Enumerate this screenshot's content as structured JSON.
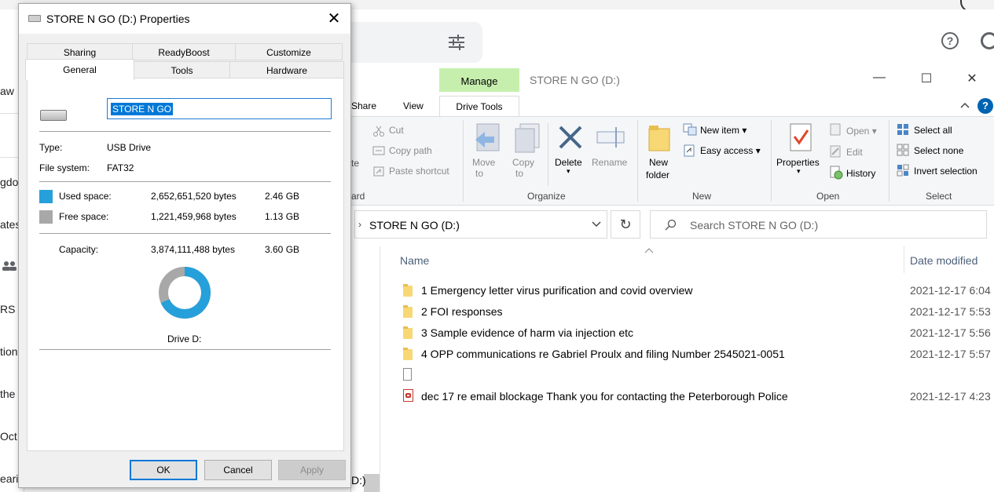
{
  "browser": {
    "left_fragments": [
      "aw",
      "gdo",
      "ates",
      "RS c",
      "tion",
      "the",
      "Oct",
      "earin"
    ],
    "help_label": "?"
  },
  "explorer": {
    "manage_label": "Manage",
    "title": "STORE N GO (D:)",
    "window_controls": {
      "minimize": "—",
      "maximize": "☐",
      "close": "✕"
    },
    "tabs": {
      "share": "Share",
      "view": "View",
      "drive_tools": "Drive Tools"
    },
    "ribbon": {
      "clipboard": {
        "cut": "Cut",
        "copy_path": "Copy path",
        "paste_shortcut": "Paste shortcut",
        "paste_fragment": "te",
        "group_fragment": "ard"
      },
      "organize": {
        "move_to_1": "Move",
        "move_to_2": "to",
        "copy_to_1": "Copy",
        "copy_to_2": "to",
        "delete": "Delete",
        "rename": "Rename",
        "group": "Organize"
      },
      "new": {
        "new_folder_1": "New",
        "new_folder_2": "folder",
        "new_item": "New item",
        "easy_access": "Easy access",
        "group": "New"
      },
      "open": {
        "properties": "Properties",
        "open": "Open",
        "edit": "Edit",
        "history": "History",
        "group": "Open"
      },
      "select": {
        "select_all": "Select all",
        "select_none": "Select none",
        "invert_selection": "Invert selection",
        "group": "Select"
      }
    },
    "address": {
      "path": "STORE N GO (D:)"
    },
    "search": {
      "placeholder": "Search STORE N GO (D:)"
    },
    "columns": {
      "name": "Name",
      "date_modified": "Date modified"
    },
    "files": [
      {
        "type": "folder",
        "name": "1 Emergency letter virus purification and covid overview",
        "date": "2021-12-17 6:04"
      },
      {
        "type": "folder",
        "name": "2 FOI responses",
        "date": "2021-12-17 5:53"
      },
      {
        "type": "folder",
        "name": "3 Sample evidence of harm via injection etc",
        "date": "2021-12-17 5:56"
      },
      {
        "type": "folder",
        "name": "4 OPP communications re Gabriel Proulx and filing Number 2545021-0051",
        "date": "2021-12-17 5:57"
      },
      {
        "type": "file",
        "name": "",
        "date": ""
      },
      {
        "type": "pdf",
        "name": "dec 17 re email blockage Thank you for contacting the Peterborough Police",
        "date": "2021-12-17 4:23"
      }
    ],
    "status_fragment": "D:)"
  },
  "dialog": {
    "title": "STORE N GO (D:) Properties",
    "tabs": {
      "sharing": "Sharing",
      "readyboost": "ReadyBoost",
      "customize": "Customize",
      "general": "General",
      "tools": "Tools",
      "hardware": "Hardware"
    },
    "name_value": "STORE N GO",
    "type_label": "Type:",
    "type_value": "USB Drive",
    "fs_label": "File system:",
    "fs_value": "FAT32",
    "used": {
      "label": "Used space:",
      "bytes": "2,652,651,520 bytes",
      "size": "2.46 GB",
      "color": "#26a0da"
    },
    "free": {
      "label": "Free space:",
      "bytes": "1,221,459,968 bytes",
      "size": "1.13 GB",
      "color": "#a8a8a8"
    },
    "capacity": {
      "label": "Capacity:",
      "bytes": "3,874,111,488 bytes",
      "size": "3.60 GB"
    },
    "used_fraction": 0.6847,
    "drive_label": "Drive D:",
    "buttons": {
      "ok": "OK",
      "cancel": "Cancel",
      "apply": "Apply"
    }
  }
}
